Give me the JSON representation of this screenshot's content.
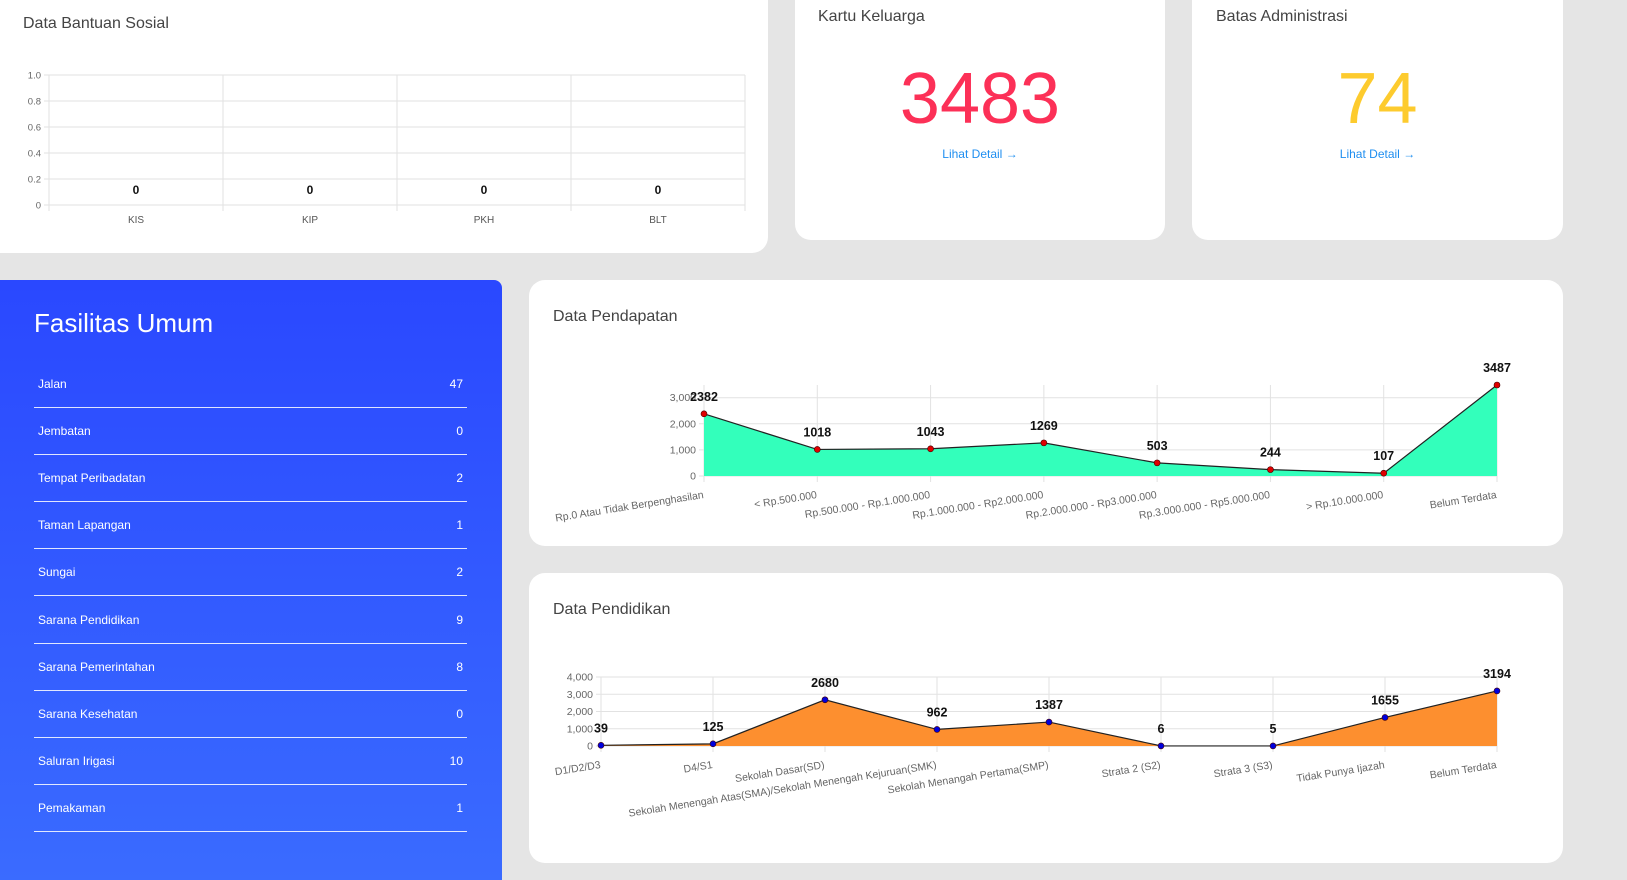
{
  "bantuan": {
    "title": "Data Bantuan Sosial"
  },
  "kartu": {
    "title": "Kartu Keluarga",
    "value": "3483",
    "link": "Lihat Detail",
    "color": "#fc3057"
  },
  "batas": {
    "title": "Batas Administrasi",
    "value": "74",
    "link": "Lihat Detail",
    "color": "#fdcb2e"
  },
  "fasilitas": {
    "title": "Fasilitas Umum",
    "items": [
      {
        "label": "Jalan",
        "value": "47"
      },
      {
        "label": "Jembatan",
        "value": "0"
      },
      {
        "label": "Tempat Peribadatan",
        "value": "2"
      },
      {
        "label": "Taman Lapangan",
        "value": "1"
      },
      {
        "label": "Sungai",
        "value": "2"
      },
      {
        "label": "Sarana Pendidikan",
        "value": "9"
      },
      {
        "label": "Sarana Pemerintahan",
        "value": "8"
      },
      {
        "label": "Sarana Kesehatan",
        "value": "0"
      },
      {
        "label": "Saluran Irigasi",
        "value": "10"
      },
      {
        "label": "Pemakaman",
        "value": "1"
      }
    ]
  },
  "pendapatan": {
    "title": "Data Pendapatan"
  },
  "pendidikan": {
    "title": "Data Pendidikan"
  },
  "chart_data": [
    {
      "type": "bar",
      "categories": [
        "KIS",
        "KIP",
        "PKH",
        "BLT"
      ],
      "values": [
        0,
        0,
        0,
        0
      ],
      "ylim": [
        0,
        1
      ],
      "yticks": [
        0,
        0.2,
        0.4,
        0.6,
        0.8,
        1.0
      ],
      "grid": true
    },
    {
      "type": "area",
      "categories": [
        "Rp.0 Atau Tidak Berpenghasilan",
        "< Rp.500.000",
        "Rp.500.000 - Rp.1.000.000",
        "Rp.1.000.000 - Rp2.000.000",
        "Rp.2.000.000 - Rp3.000.000",
        "Rp.3.000.000 - Rp5.000.000",
        "> Rp.10.000.000",
        "Belum Terdata"
      ],
      "values": [
        2382,
        1018,
        1043,
        1269,
        503,
        244,
        107,
        3487
      ],
      "ylim": [
        0,
        3487
      ],
      "yticks": [
        0,
        1000,
        2000,
        3000
      ],
      "fill": "#33ffbb",
      "point": "#e00000",
      "grid": true
    },
    {
      "type": "area",
      "categories": [
        "D1/D2/D3",
        "D4/S1",
        "Sekolah Dasar(SD)",
        "Sekolah Menengah Atas(SMA)/Sekolah Menengah Kejuruan(SMK)",
        "Sekolah Menangah Pertama(SMP)",
        "Strata 2 (S2)",
        "Strata 3 (S3)",
        "Tidak Punya Ijazah",
        "Belum Terdata"
      ],
      "values": [
        39,
        125,
        2680,
        962,
        1387,
        6,
        5,
        1655,
        3194
      ],
      "ylim": [
        0,
        4000
      ],
      "yticks": [
        0,
        1000,
        2000,
        3000,
        4000
      ],
      "fill": "#fd8f2f",
      "point": "#0000dd",
      "grid": true
    }
  ]
}
